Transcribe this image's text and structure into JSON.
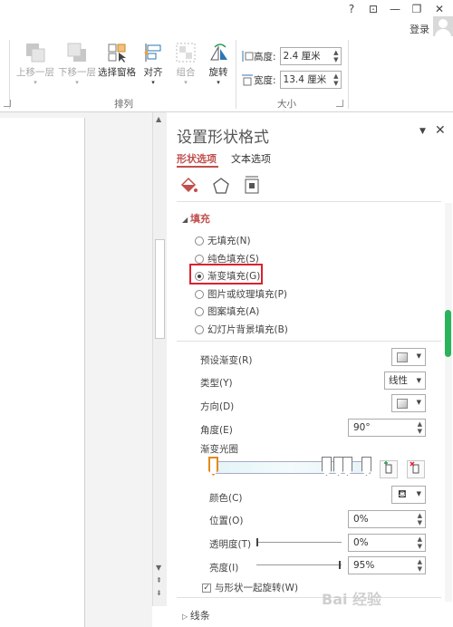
{
  "titlebar": {
    "help": "?",
    "restore_ribbon": "⊡",
    "minimize": "—",
    "maximize": "❐",
    "close": "✕",
    "login": "登录"
  },
  "ribbon": {
    "bring_forward": "上移一层",
    "send_backward": "下移一层",
    "selection_pane": "选择窗格",
    "align": "对齐",
    "group": "组合",
    "rotate": "旋转",
    "arrange_group": "排列",
    "height_label": "高度:",
    "height_value": "2.4 厘米",
    "width_label": "宽度:",
    "width_value": "13.4 厘米",
    "size_group": "大小"
  },
  "pane": {
    "title": "设置形状格式",
    "tabs": [
      "形状选项",
      "文本选项"
    ],
    "fill_section": "填充",
    "fill_options": [
      {
        "label": "无填充(N)",
        "checked": false
      },
      {
        "label": "纯色填充(S)",
        "checked": false
      },
      {
        "label": "渐变填充(G)",
        "checked": true
      },
      {
        "label": "图片或纹理填充(P)",
        "checked": false
      },
      {
        "label": "图案填充(A)",
        "checked": false
      },
      {
        "label": "幻灯片背景填充(B)",
        "checked": false
      }
    ],
    "preset_label": "预设渐变(R)",
    "type_label": "类型(Y)",
    "type_value": "线性",
    "direction_label": "方向(D)",
    "angle_label": "角度(E)",
    "angle_value": "90°",
    "stops_label": "渐变光圈",
    "color_label": "颜色(C)",
    "position_label": "位置(O)",
    "position_value": "0%",
    "transparency_label": "透明度(T)",
    "transparency_value": "0%",
    "brightness_label": "亮度(I)",
    "brightness_value": "95%",
    "rotate_with_shape": "与形状一起旋转(W)",
    "line_section": "线条"
  },
  "watermark": "Bai 经验"
}
